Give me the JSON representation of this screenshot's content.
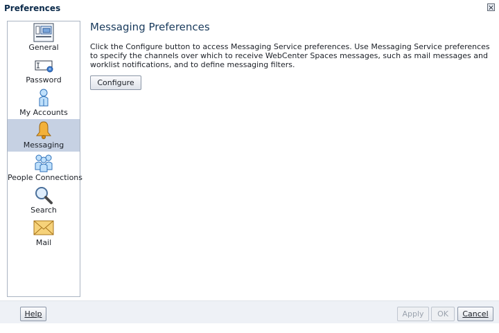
{
  "dialog": {
    "title": "Preferences"
  },
  "sidebar": {
    "items": [
      {
        "label": "General",
        "icon": "general-settings-icon",
        "selected": false
      },
      {
        "label": "Password",
        "icon": "password-icon",
        "selected": false
      },
      {
        "label": "My Accounts",
        "icon": "my-accounts-icon",
        "selected": false
      },
      {
        "label": "Messaging",
        "icon": "bell-icon",
        "selected": true
      },
      {
        "label": "People Connections",
        "icon": "people-connections-icon",
        "selected": false
      },
      {
        "label": "Search",
        "icon": "magnifier-icon",
        "selected": false
      },
      {
        "label": "Mail",
        "icon": "envelope-icon",
        "selected": false
      }
    ]
  },
  "main": {
    "title": "Messaging Preferences",
    "description": "Click the Configure button to access Messaging Service preferences. Use Messaging Service preferences to specify the channels over which to receive WebCenter Spaces messages, such as mail messages and worklist notifications, and to define messaging filters.",
    "configure_label": "Configure"
  },
  "footer": {
    "help_label": "Help",
    "apply_label": "Apply",
    "ok_label": "OK",
    "cancel_label": "Cancel"
  },
  "colors": {
    "selected_bg": "#c6d1e3",
    "title_color": "#183a5c",
    "footer_bg": "#eef1f6"
  }
}
